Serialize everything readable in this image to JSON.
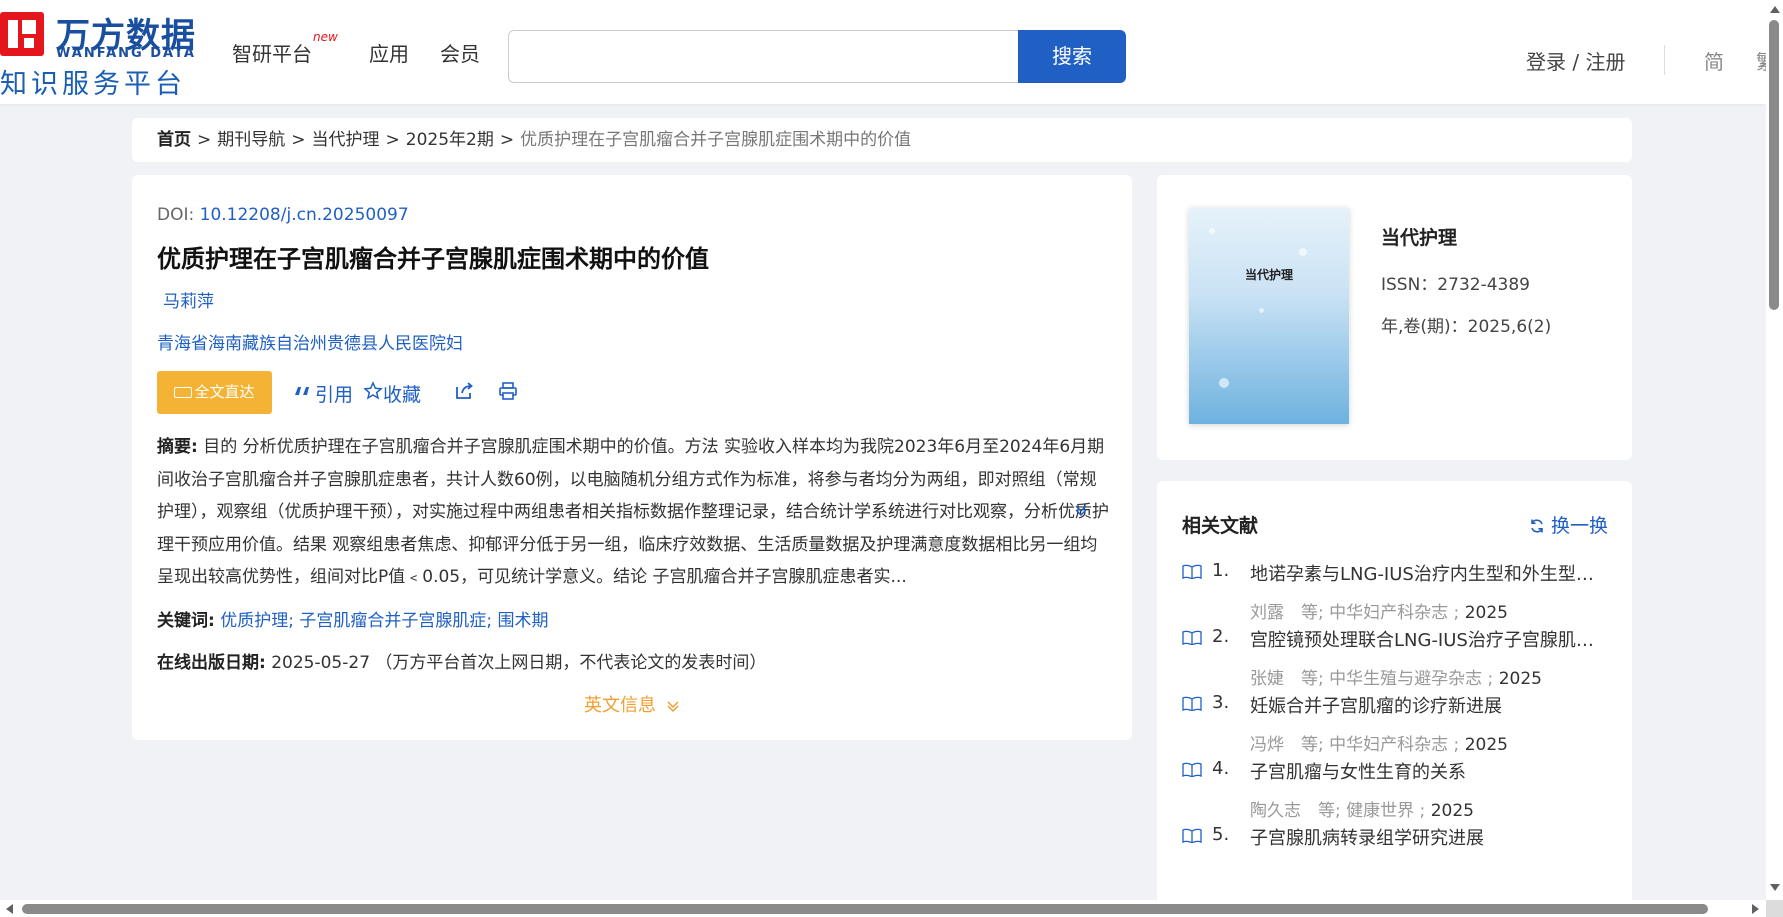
{
  "header": {
    "logo_cn": "万方数据",
    "logo_en": "WANFANG DATA",
    "logo_sub": "知识服务平台",
    "nav": [
      {
        "label": "智研平台",
        "badge": "new"
      },
      {
        "label": "应用"
      },
      {
        "label": "会员"
      }
    ],
    "search_value": "",
    "search_button": "搜索",
    "login": "登录 / 注册",
    "lang": "简",
    "lang2": "繁"
  },
  "breadcrumb": {
    "items": [
      "首页",
      "期刊导航",
      "当代护理",
      "2025年2期"
    ],
    "current": "优质护理在子宫肌瘤合并子宫腺肌症围术期中的价值",
    "separator": ">"
  },
  "article": {
    "doi_label": "DOI: ",
    "doi": "10.12208/j.cn.20250097",
    "title": "优质护理在子宫肌瘤合并子宫腺肌症围术期中的价值",
    "author": "马莉萍",
    "organization": "青海省海南藏族自治州贵德县人民医院妇",
    "actions": {
      "fulltext": "全文直达",
      "cite": "引用",
      "favorite": "收藏"
    },
    "abstract_label": "摘要:",
    "abstract": " 目的 分析优质护理在子宫肌瘤合并子宫腺肌症围术期中的价值。方法 实验收入样本均为我院2023年6月至2024年6月期间收治子宫肌瘤合并子宫腺肌症患者，共计人数60例，以电脑随机分组方式作为标准，将参与者均分为两组，即对照组（常规护理），观察组（优质护理干预），对实施过程中两组患者相关指标数据作整理记录，结合统计学系统进行对比观察，分析优质护理干预应用价值。结果 观察组患者焦虑、抑郁评分低于另一组，临床疗效数据、生活质量数据及护理满意度数据相比另一组均呈现出较高优势性，组间对比P值﹤0.05，可见统计学意义。结论 子宫肌瘤合并子宫腺肌症患者实...",
    "keywords_label": "关键词:",
    "keywords": [
      "优质护理",
      "子宫肌瘤合并子宫腺肌症",
      "围术期"
    ],
    "pubdate_label": "在线出版日期:",
    "pubdate": "2025-05-27",
    "pubdate_note": "（万方平台首次上网日期，不代表论文的发表时间）",
    "en_info": "英文信息"
  },
  "journal": {
    "cover_title": "当代护理",
    "name": "当代护理",
    "issn": "ISSN：2732-4389",
    "volume": "年,卷(期)：2025,6(2)"
  },
  "related": {
    "title": "相关文献",
    "refresh": "换一换",
    "items": [
      {
        "num": "1.",
        "title": "地诺孕素与LNG-IUS治疗内生型和外生型子宫腺肌病的效果比较",
        "authors": "刘露　等;",
        "journal": "中华妇产科杂志 ;",
        "year": "2025"
      },
      {
        "num": "2.",
        "title": "宫腔镜预处理联合LNG-IUS治疗子宫腺肌病的疗效分析",
        "authors": "张婕　等;",
        "journal": "中华生殖与避孕杂志 ;",
        "year": "2025"
      },
      {
        "num": "3.",
        "title": "妊娠合并子宫肌瘤的诊疗新进展",
        "authors": "冯烨　等;",
        "journal": "中华妇产科杂志 ;",
        "year": "2025"
      },
      {
        "num": "4.",
        "title": "子宫肌瘤与女性生育的关系",
        "authors": "陶久志　等;",
        "journal": "健康世界 ;",
        "year": "2025"
      },
      {
        "num": "5.",
        "title": "子宫腺肌病转录组学研究进展",
        "authors": "",
        "journal": "",
        "year": ""
      }
    ]
  }
}
